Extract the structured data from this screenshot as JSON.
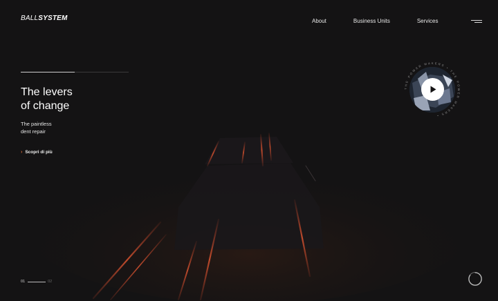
{
  "brand": {
    "logo_light": "BALL",
    "logo_bold": "SYSTEM"
  },
  "nav": {
    "items": [
      {
        "label": "About"
      },
      {
        "label": "Business Units"
      },
      {
        "label": "Services"
      }
    ],
    "menu_icon": "hamburger-icon"
  },
  "hero": {
    "progress_fraction": 0.5,
    "headline_line1": "The levers",
    "headline_line2": "of change",
    "subline_line1": "The paintless",
    "subline_line2": "dent repair",
    "cta_label": "Scopri di più",
    "cta_icon": "chevron-right-icon"
  },
  "video": {
    "play_icon": "play-icon",
    "circular_text": "THE POWER MAKERS • THE POWER MAKERS • "
  },
  "pager": {
    "current": "01",
    "next": "02"
  },
  "scroll": {
    "icon": "scroll-progress-icon",
    "progress_fraction": 0.85
  },
  "colors": {
    "background": "#141314",
    "accent": "#d46a3a",
    "light_streak": "#c4452a"
  }
}
